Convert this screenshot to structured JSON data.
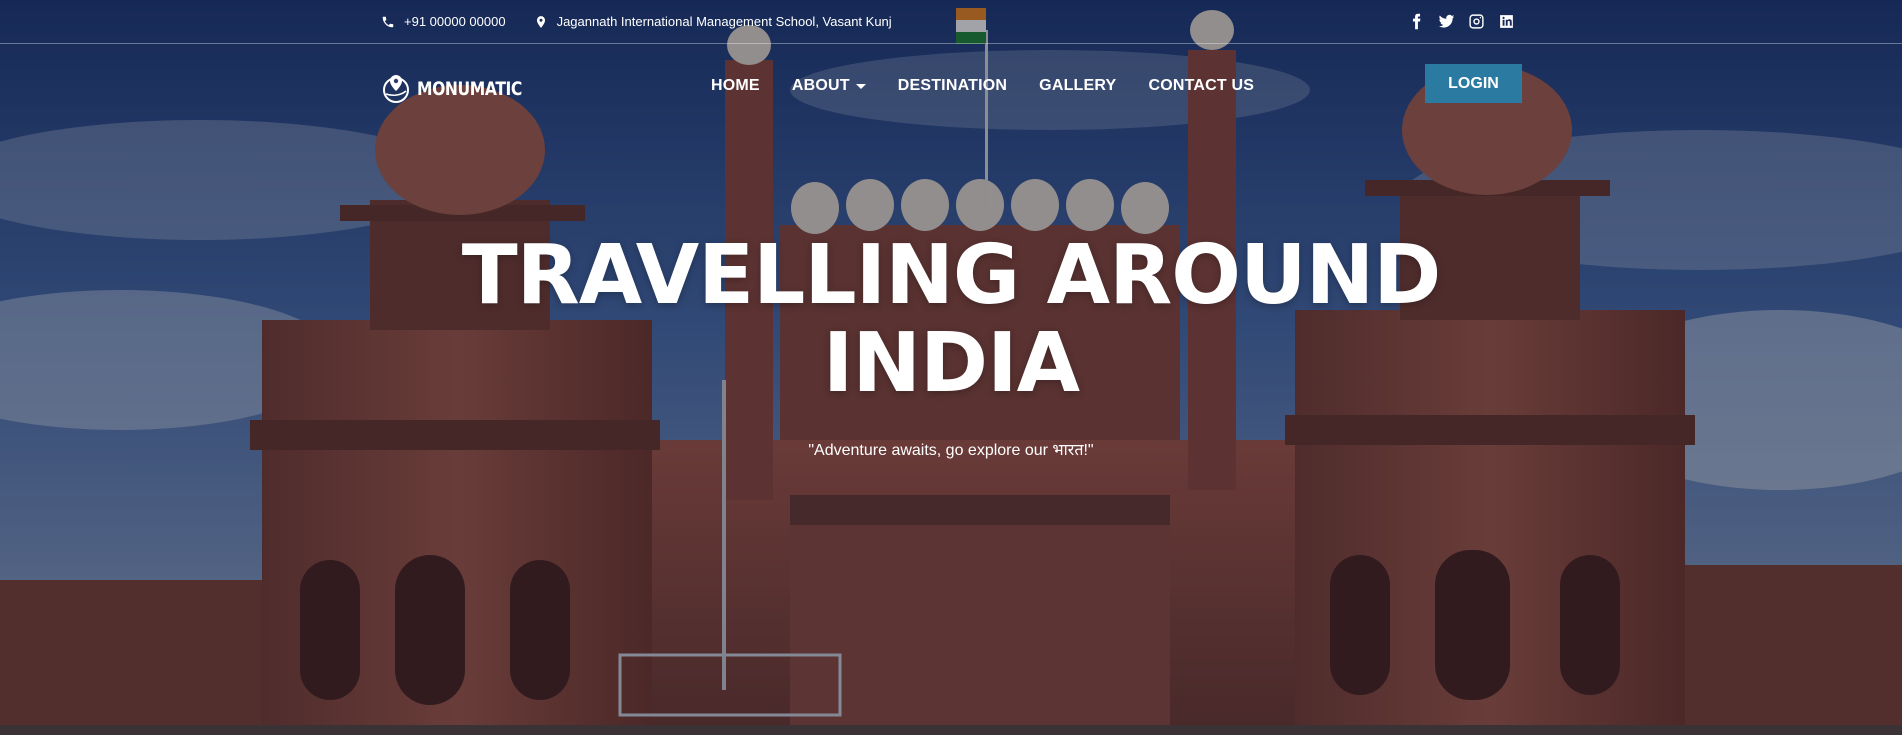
{
  "topbar": {
    "phone": "+91 00000 00000",
    "address": "Jagannath International Management School, Vasant Kunj",
    "social": [
      {
        "icon": "facebook-icon"
      },
      {
        "icon": "twitter-icon"
      },
      {
        "icon": "instagram-icon"
      },
      {
        "icon": "linkedin-icon"
      }
    ]
  },
  "brand": {
    "name": "MONUMATIC"
  },
  "nav": {
    "items": [
      {
        "label": "HOME"
      },
      {
        "label": "ABOUT",
        "has_dropdown": true
      },
      {
        "label": "DESTINATION"
      },
      {
        "label": "GALLERY"
      },
      {
        "label": "CONTACT US"
      }
    ],
    "login_label": "LOGIN"
  },
  "hero": {
    "title_line1": "TRAVELLING AROUND",
    "title_line2": "INDIA",
    "quote": "\"Adventure awaits, go explore our भारत!\""
  },
  "colors": {
    "accent": "#2b7aa1",
    "sky": "#3a5a9a",
    "sandstone": "#8a4a3e"
  }
}
